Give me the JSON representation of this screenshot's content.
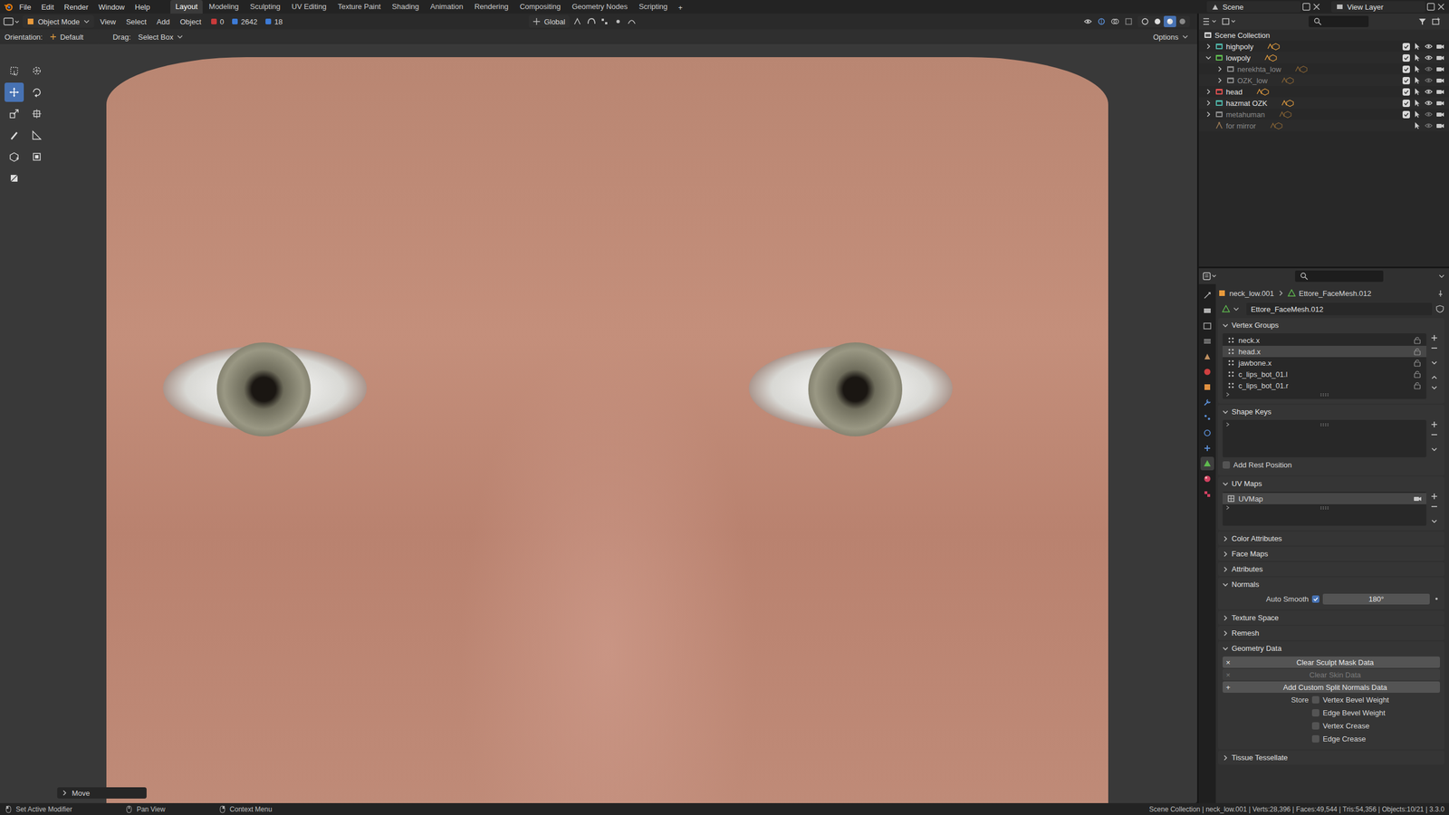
{
  "topbar": {
    "menus": [
      "File",
      "Edit",
      "Render",
      "Window",
      "Help"
    ],
    "workspaces": [
      {
        "label": "Layout",
        "selected": true
      },
      {
        "label": "Modeling",
        "selected": false
      },
      {
        "label": "Sculpting",
        "selected": false
      },
      {
        "label": "UV Editing",
        "selected": false
      },
      {
        "label": "Texture Paint",
        "selected": false
      },
      {
        "label": "Shading",
        "selected": false
      },
      {
        "label": "Animation",
        "selected": false
      },
      {
        "label": "Rendering",
        "selected": false
      },
      {
        "label": "Compositing",
        "selected": false
      },
      {
        "label": "Geometry Nodes",
        "selected": false
      },
      {
        "label": "Scripting",
        "selected": false
      }
    ],
    "add_tab": "+",
    "scene": "Scene",
    "view_layer": "View Layer"
  },
  "viewport": {
    "header": {
      "mode": "Object Mode",
      "menus": [
        "View",
        "Select",
        "Add",
        "Object"
      ],
      "stats": [
        {
          "value": "0",
          "color": "#c83a3a"
        },
        {
          "value": "2642",
          "color": "#3d7bd6"
        },
        {
          "value": "18",
          "color": "#3d7bd6"
        }
      ],
      "orientation": "Global",
      "shading": [
        {
          "selected": false
        },
        {
          "selected": false
        },
        {
          "selected": true
        },
        {
          "selected": false
        }
      ]
    },
    "tool_settings": {
      "orientation_label": "Orientation:",
      "orientation": "Default",
      "drag_label": "Drag:",
      "drag": "Select Box",
      "options": "Options"
    },
    "tools": [
      {
        "selected": false
      },
      {
        "selected": false
      },
      {
        "selected": true
      },
      {
        "selected": false
      },
      {
        "selected": false
      },
      {
        "selected": false
      },
      {
        "selected": false
      },
      {
        "selected": false
      },
      {
        "selected": false
      },
      {
        "selected": false
      },
      {
        "selected": false
      }
    ],
    "operator_panel": {
      "title": "Move",
      "expanded": false
    }
  },
  "outliner": {
    "root": "Scene Collection",
    "items": [
      {
        "label": "highpoly",
        "kind": "collection",
        "color": "#4fb3a6",
        "expandable": true,
        "expanded": false,
        "greyed": false,
        "checked": true,
        "children": []
      },
      {
        "label": "lowpoly",
        "kind": "collection",
        "color": "#5fb94f",
        "expandable": true,
        "expanded": true,
        "greyed": false,
        "checked": true,
        "children": [
          {
            "label": "nerekhta_low",
            "kind": "collection",
            "color": "#8a8a8a",
            "expandable": true,
            "expanded": false,
            "greyed": true,
            "checked": true,
            "children": []
          },
          {
            "label": "OZK_low",
            "kind": "collection",
            "color": "#8a8a8a",
            "expandable": true,
            "expanded": false,
            "greyed": true,
            "checked": true,
            "children": []
          }
        ]
      },
      {
        "label": "head",
        "kind": "collection",
        "color": "#e05050",
        "expandable": true,
        "expanded": false,
        "greyed": false,
        "checked": true,
        "children": []
      },
      {
        "label": "hazmat OZK",
        "kind": "collection",
        "color": "#4fb3a6",
        "expandable": true,
        "expanded": false,
        "greyed": false,
        "checked": true,
        "children": []
      },
      {
        "label": "metahuman",
        "kind": "collection",
        "color": "#8a8a8a",
        "expandable": true,
        "expanded": false,
        "greyed": true,
        "checked": true,
        "children": []
      },
      {
        "label": "for mirror",
        "kind": "object",
        "color": "#9a7a55",
        "expandable": false,
        "expanded": false,
        "greyed": true,
        "children": []
      }
    ]
  },
  "properties": {
    "tabs": [
      {
        "selected": false,
        "color": "#b0b0b0"
      },
      {
        "selected": false,
        "color": "#b0b0b0"
      },
      {
        "selected": false,
        "color": "#b0b0b0"
      },
      {
        "selected": false,
        "color": "#b0b0b0"
      },
      {
        "selected": false,
        "color": "#c09060"
      },
      {
        "selected": false,
        "color": "#d04040"
      },
      {
        "selected": false,
        "color": "#e09040"
      },
      {
        "selected": false,
        "color": "#5b8fd6"
      },
      {
        "selected": false,
        "color": "#5b8fd6"
      },
      {
        "selected": false,
        "color": "#5b8fd6"
      },
      {
        "selected": false,
        "color": "#5b8fd6"
      },
      {
        "selected": true,
        "color": "#5fb94f"
      },
      {
        "selected": false,
        "color": "#d04060"
      },
      {
        "selected": false,
        "color": "#d04060"
      }
    ],
    "breadcrumb": [
      "neck_low.001",
      "Ettore_FaceMesh.012"
    ],
    "mesh_name": "Ettore_FaceMesh.012",
    "panels": [
      {
        "title": "Vertex Groups",
        "expanded": true,
        "kind": "list",
        "items": [
          {
            "label": "neck.x",
            "selected": false
          },
          {
            "label": "head.x",
            "selected": true
          },
          {
            "label": "jawbone.x",
            "selected": false
          },
          {
            "label": "c_lips_bot_01.l",
            "selected": false
          },
          {
            "label": "c_lips_bot_01.r",
            "selected": false
          }
        ]
      },
      {
        "title": "Shape Keys",
        "expanded": true,
        "kind": "list",
        "items": [],
        "checkbox": {
          "label": "Add Rest Position",
          "checked": false
        }
      },
      {
        "title": "UV Maps",
        "expanded": true,
        "kind": "list",
        "items": [
          {
            "label": "UVMap",
            "selected": true
          }
        ]
      },
      {
        "title": "Color Attributes",
        "expanded": false,
        "kind": "collapsed"
      },
      {
        "title": "Face Maps",
        "expanded": false,
        "kind": "collapsed"
      },
      {
        "title": "Attributes",
        "expanded": false,
        "kind": "collapsed"
      },
      {
        "title": "Normals",
        "expanded": true,
        "kind": "normals",
        "auto_smooth": {
          "label": "Auto Smooth",
          "checked": true,
          "value": "180°"
        }
      },
      {
        "title": "Texture Space",
        "expanded": false,
        "kind": "collapsed"
      },
      {
        "title": "Remesh",
        "expanded": false,
        "kind": "collapsed"
      },
      {
        "title": "Geometry Data",
        "expanded": true,
        "kind": "geometry",
        "buttons": [
          {
            "icon": "×",
            "label": "Clear Sculpt Mask Data",
            "disabled": false
          },
          {
            "icon": "×",
            "label": "Clear Skin Data",
            "disabled": true
          },
          {
            "icon": "+",
            "label": "Add Custom Split Normals Data",
            "disabled": false
          }
        ],
        "store_label": "Store",
        "options": [
          {
            "label": "Vertex Bevel Weight",
            "checked": false
          },
          {
            "label": "Edge Bevel Weight",
            "checked": false
          },
          {
            "label": "Vertex Crease",
            "checked": false
          },
          {
            "label": "Edge Crease",
            "checked": false
          }
        ]
      },
      {
        "title": "Tissue Tessellate",
        "expanded": false,
        "kind": "collapsed"
      }
    ]
  },
  "status_bar": {
    "hints": [
      "Set Active Modifier",
      "Pan View",
      "Context Menu"
    ],
    "stats": "Scene Collection | neck_low.001 | Verts:28,396 | Faces:49,544 | Tris:54,356 | Objects:10/21 | 3.3.0"
  }
}
